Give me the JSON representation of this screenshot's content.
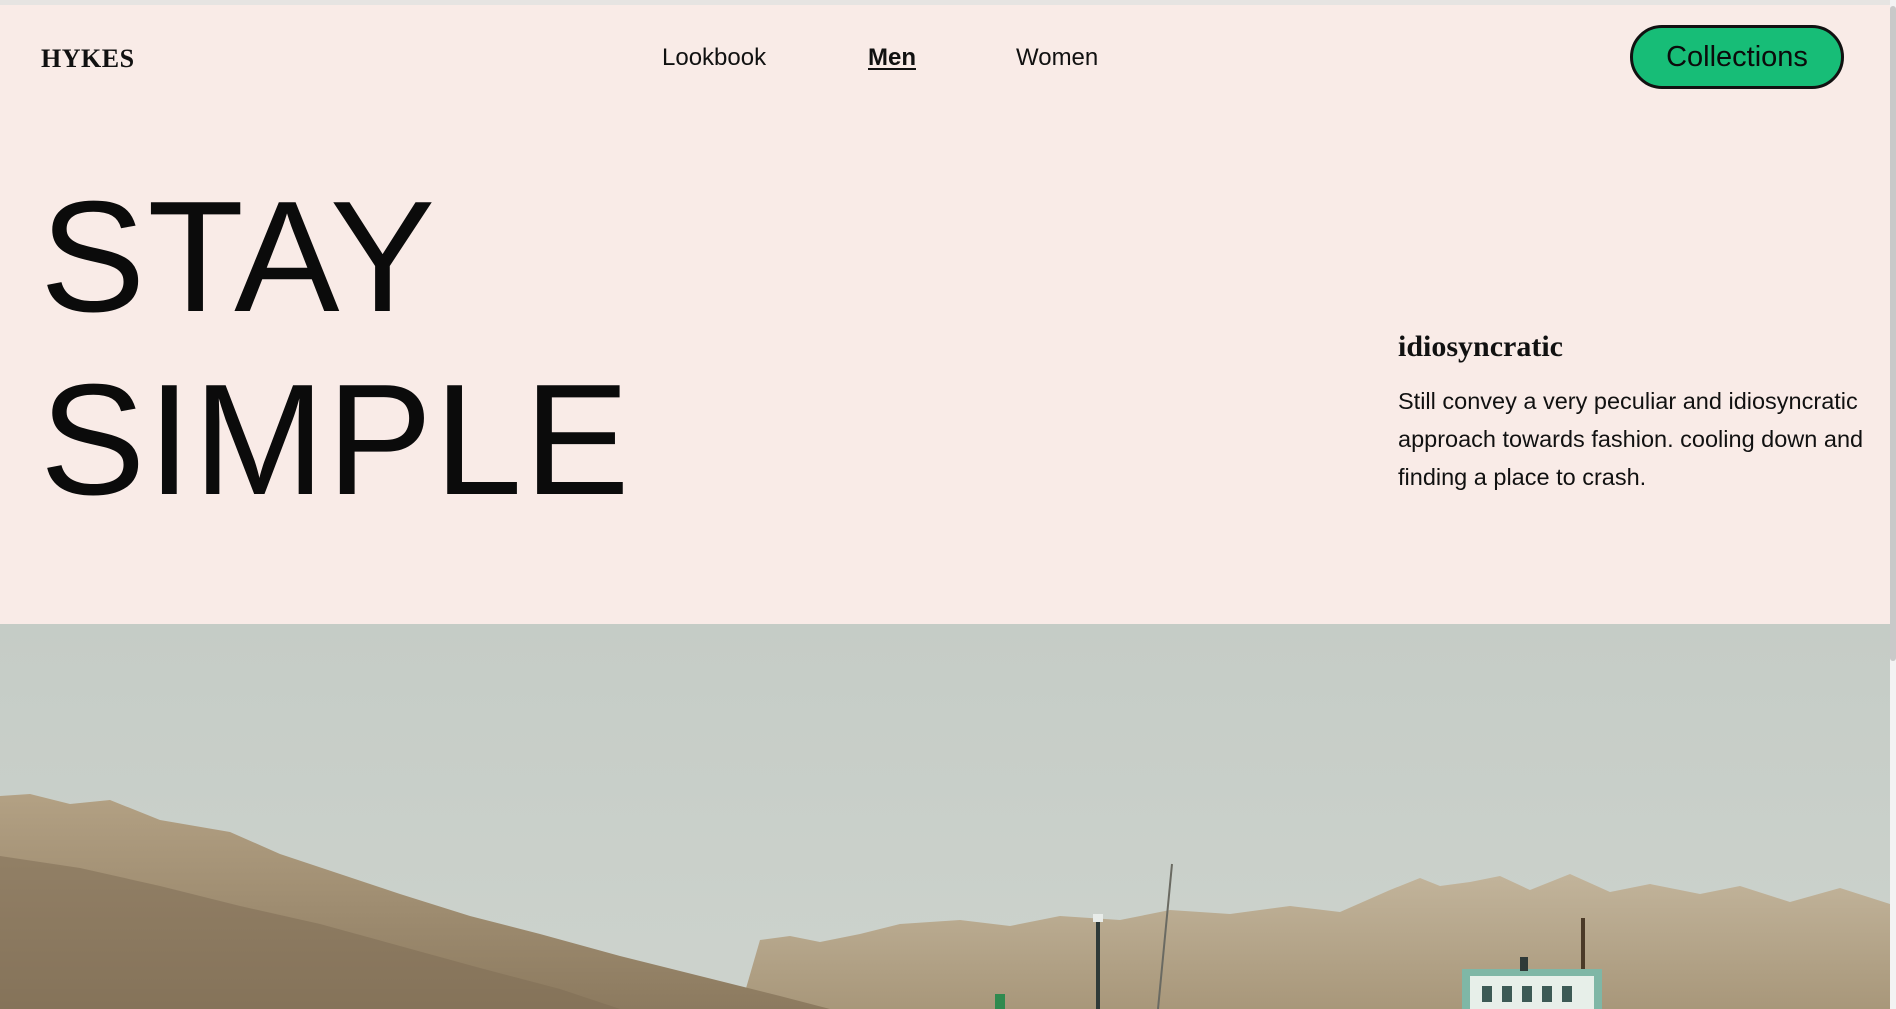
{
  "brand": {
    "logo_text": "HYKES"
  },
  "nav": {
    "items": [
      {
        "label": "Lookbook",
        "active": false
      },
      {
        "label": "Men",
        "active": true
      },
      {
        "label": "Women",
        "active": false
      }
    ]
  },
  "cta": {
    "label": "Collections"
  },
  "hero": {
    "line1": "STAY",
    "line2": "SIMPLE",
    "aside_title": "idiosyncratic",
    "aside_body": "Still convey a very peculiar and idiosyncratic approach towards fashion. cooling down and finding a place to crash."
  },
  "colors": {
    "background": "#f9ebe7",
    "accent": "#17bd77",
    "text": "#111111",
    "sky": "#c9d0ca"
  },
  "photo": {
    "icon": "landscape-photo-icon"
  }
}
